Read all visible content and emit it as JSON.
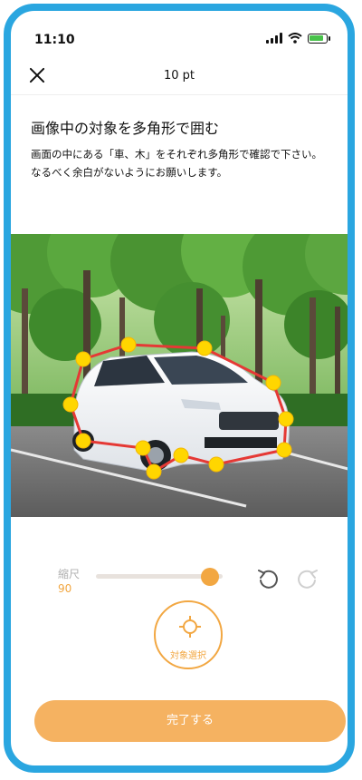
{
  "status_bar": {
    "time": "11:10",
    "battery_color": "#48c24a"
  },
  "header": {
    "points": "10 pt"
  },
  "task": {
    "title": "画像中の対象を多角形で囲む",
    "description_line1": "画面の中にある「車、木」をそれぞれ多角形で確認で下さい。",
    "description_line2": "なるべく余白がないようにお願いします。"
  },
  "zoom": {
    "label": "縮尺",
    "value": "90",
    "fraction": 0.9
  },
  "target_button": {
    "label": "対象選択"
  },
  "done_button": {
    "label": "完了する"
  },
  "colors": {
    "accent": "#f2a742",
    "frame": "#2aa6e0",
    "polygon": "#e53935",
    "vertex": "#ffd600"
  },
  "icons": {
    "close": "close-icon",
    "undo": "undo-icon",
    "redo": "redo-icon",
    "target": "crosshair-icon"
  }
}
